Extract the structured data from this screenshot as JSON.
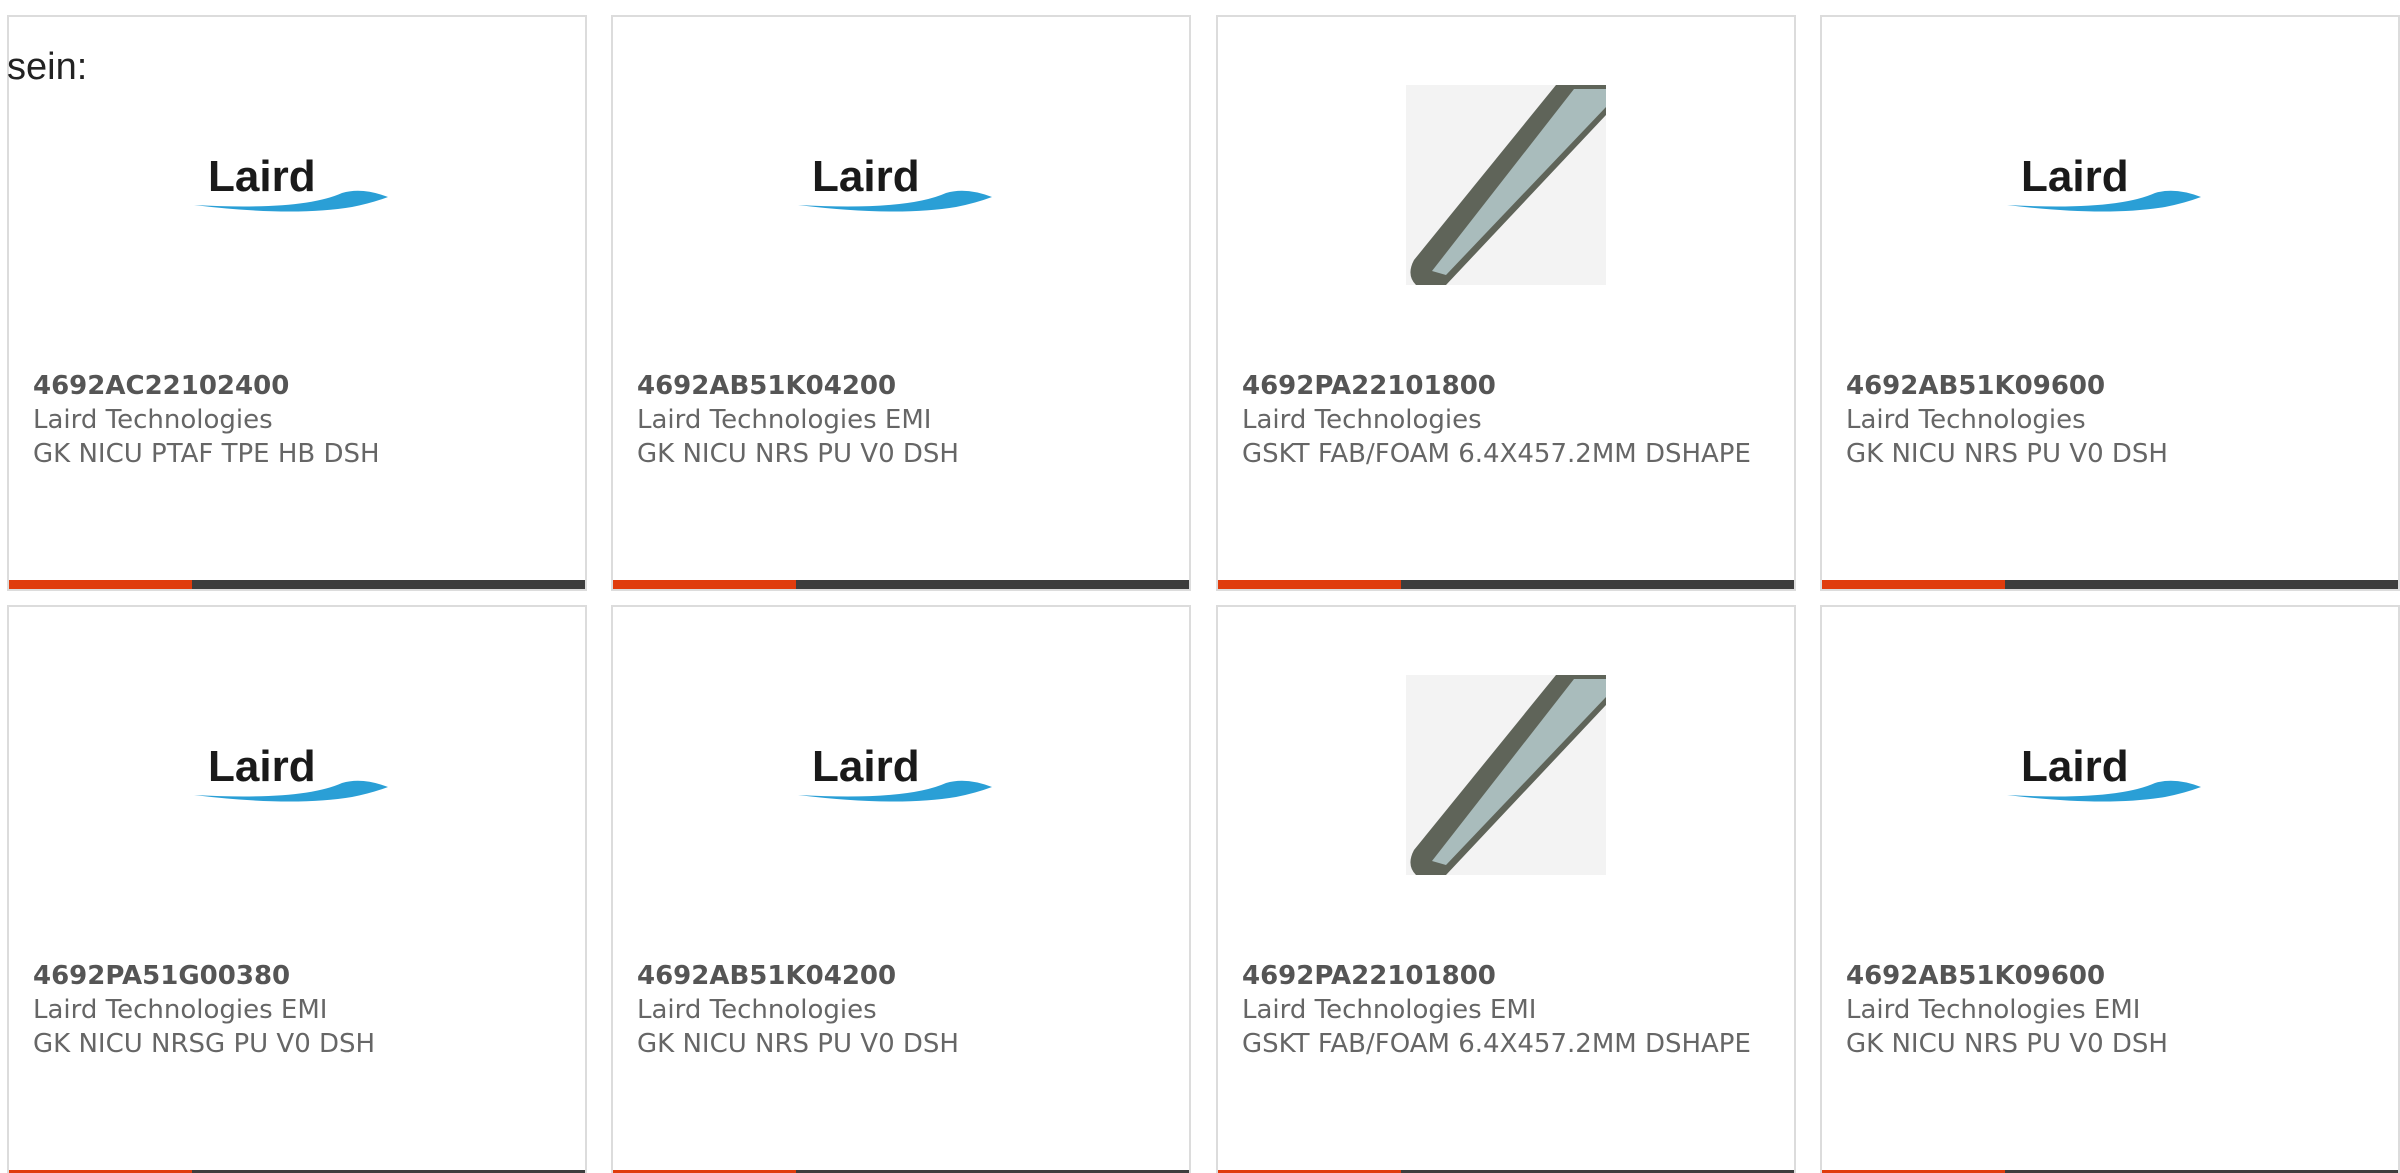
{
  "intro_text": "sein:",
  "colors": {
    "accent_bar": "#e03c0d",
    "dark_bar": "#3d3d3d",
    "card_border": "#dcdcdc",
    "logo_blue": "#2a9fd6",
    "logo_text": "#1a1a1a"
  },
  "logo": {
    "text": "Laird",
    "icon": "laird-logo"
  },
  "products": [
    {
      "part_number": "4692AC22102400",
      "manufacturer": "Laird Technologies",
      "description": "GK NICU PTAF TPE HB DSH",
      "image": "laird-logo"
    },
    {
      "part_number": "4692AB51K04200",
      "manufacturer": "Laird Technologies EMI",
      "description": "GK NICU NRS PU V0 DSH",
      "image": "laird-logo"
    },
    {
      "part_number": "4692PA22101800",
      "manufacturer": "Laird Technologies",
      "description": "GSKT FAB/FOAM 6.4X457.2MM DSHAPE",
      "image": "gasket-strip"
    },
    {
      "part_number": "4692AB51K09600",
      "manufacturer": "Laird Technologies",
      "description": "GK NICU NRS PU V0 DSH",
      "image": "laird-logo"
    },
    {
      "part_number": "4692PA51G00380",
      "manufacturer": "Laird Technologies EMI",
      "description": "GK NICU NRSG PU V0 DSH",
      "image": "laird-logo"
    },
    {
      "part_number": "4692AB51K04200",
      "manufacturer": "Laird Technologies",
      "description": "GK NICU NRS PU V0 DSH",
      "image": "laird-logo"
    },
    {
      "part_number": "4692PA22101800",
      "manufacturer": "Laird Technologies EMI",
      "description": "GSKT FAB/FOAM 6.4X457.2MM DSHAPE",
      "image": "gasket-strip"
    },
    {
      "part_number": "4692AB51K09600",
      "manufacturer": "Laird Technologies EMI",
      "description": "GK NICU NRS PU V0 DSH",
      "image": "laird-logo"
    }
  ]
}
